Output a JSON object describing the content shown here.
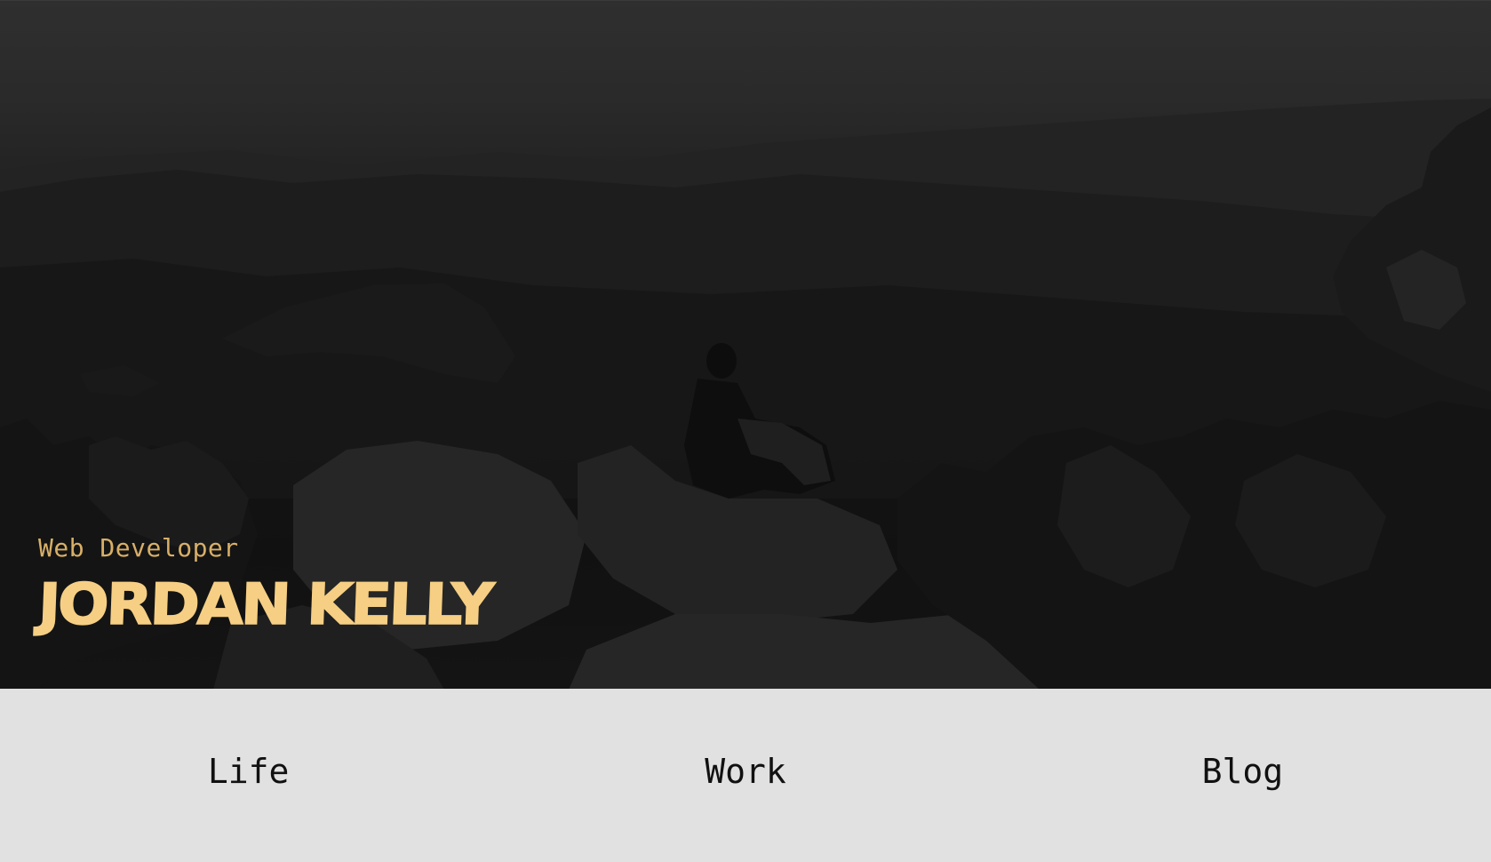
{
  "hero": {
    "subtitle": "Web Developer",
    "name": "JORDAN KELLY",
    "accent_color": "#f6cf84",
    "background_image": "dark mountain landscape with person sitting on rocks"
  },
  "nav": {
    "items": [
      {
        "label": "Life"
      },
      {
        "label": "Work"
      },
      {
        "label": "Blog"
      }
    ]
  }
}
